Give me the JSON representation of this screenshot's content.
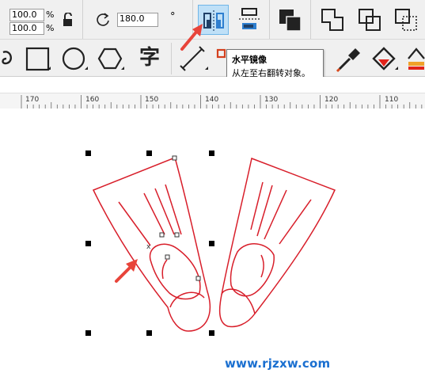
{
  "toolbar": {
    "scale_x": "100.0",
    "scale_y": "100.0",
    "scale_unit_x": "%",
    "scale_unit_y": "%",
    "rotation_angle": "180.0",
    "rotation_unit": "°"
  },
  "tool_icons": [
    "s-curve-icon",
    "rectangle-icon",
    "ellipse-icon",
    "polygon-icon",
    "text-tool-icon",
    "dimension-icon",
    "eyedropper-icon",
    "fill-icon",
    "interactive-fill-icon"
  ],
  "text_tool_glyph": "字",
  "ruler": {
    "labels": [
      "170",
      "160",
      "150",
      "140",
      "130",
      "120",
      "110"
    ]
  },
  "tooltip": {
    "title": "水平镜像",
    "description": "从左至右翻转对象。"
  },
  "watermark": "www.rjzxw.com",
  "colors": {
    "outline": "#d81e2a",
    "active_button": "#bfe0f7",
    "annotation_arrow": "#e8443a",
    "watermark": "#1a6fd0"
  }
}
